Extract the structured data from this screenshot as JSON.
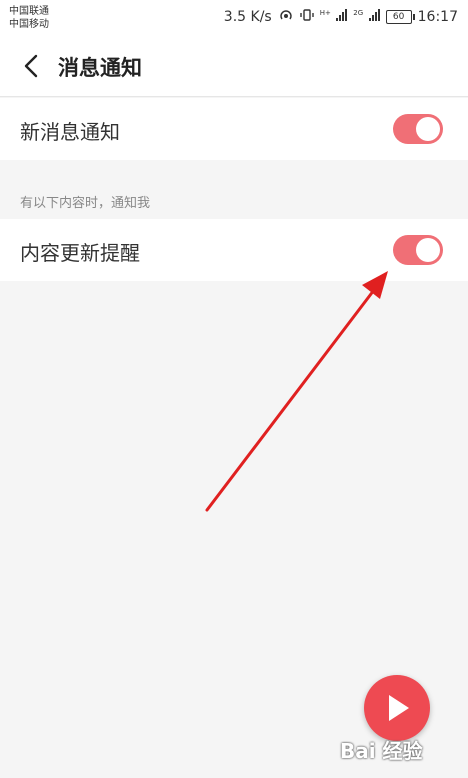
{
  "status_bar": {
    "carrier1": "中国联通",
    "carrier2": "中国移动",
    "speed": "3.5 K/s",
    "sig1_label": "H+",
    "sig2_label": "2G",
    "battery": "60",
    "time": "16:17"
  },
  "header": {
    "title": "消息通知",
    "back_icon": "chevron-left-icon"
  },
  "settings": {
    "new_message": {
      "label": "新消息通知",
      "on": true
    },
    "section_hint": "有以下内容时，通知我",
    "content_update": {
      "label": "内容更新提醒",
      "on": true
    }
  },
  "fab": {
    "icon": "play-icon"
  },
  "watermark": {
    "text": "Bai 经验"
  },
  "colors": {
    "toggle_on": "#f06f76",
    "fab": "#ee4a52",
    "annotation_arrow": "#e02020"
  }
}
